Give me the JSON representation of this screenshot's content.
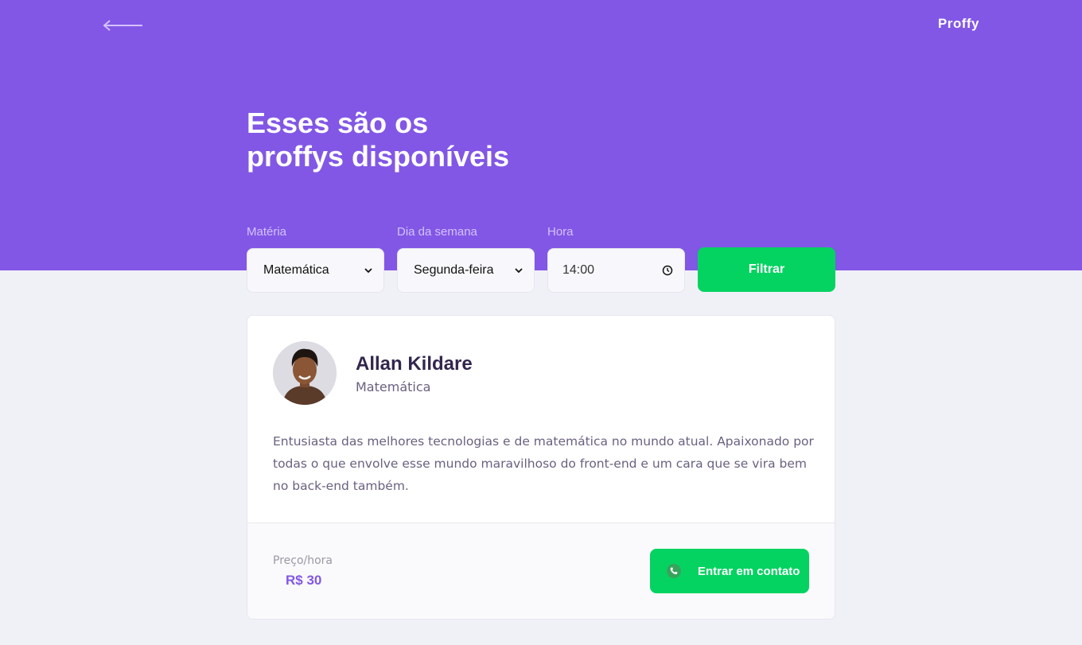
{
  "header": {
    "back_icon": "arrow-left-icon",
    "logo": "Proffy",
    "title_line1": "Esses são os",
    "title_line2": "proffys disponíveis"
  },
  "filters": {
    "subject": {
      "label": "Matéria",
      "value": "Matemática"
    },
    "weekday": {
      "label": "Dia da semana",
      "value": "Segunda-feira"
    },
    "time": {
      "label": "Hora",
      "value": "14:00"
    },
    "submit_label": "Filtrar"
  },
  "teacher": {
    "name": "Allan Kildare",
    "subject": "Matemática",
    "bio": "Entusiasta das melhores tecnologias e de matemática no mundo atual. Apaixonado por todas o que envolve esse mundo maravilhoso do front-end e um cara que se vira bem no back-end também.",
    "price_label": "Preço/hora",
    "price_value": "R$ 30",
    "contact_label": "Entrar em contato",
    "contact_icon": "whatsapp-icon"
  },
  "colors": {
    "primary": "#8257e5",
    "secondary": "#04d361",
    "background": "#f0f0f7"
  }
}
